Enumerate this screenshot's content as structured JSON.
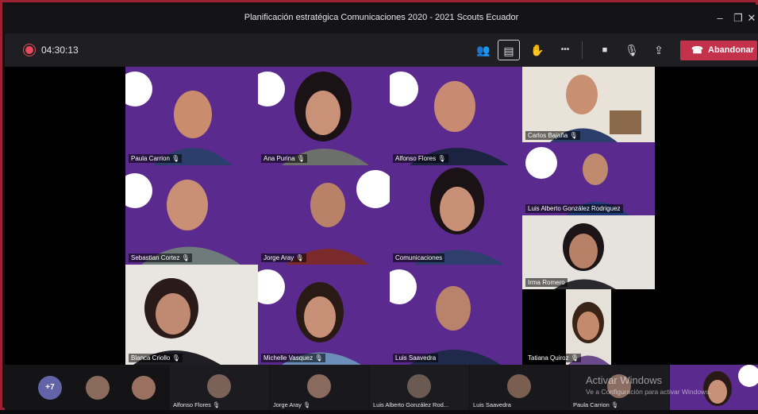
{
  "window": {
    "title": "Planificación estratégica Comunicaciones 2020 - 2021 Scouts Ecuador",
    "minimize_glyph": "–",
    "restore_glyph": "❐",
    "close_glyph": "✕"
  },
  "toolbar": {
    "timer": "04:30:13",
    "leave_label": "Abandonar",
    "buttons": [
      {
        "name": "participants-icon",
        "glyph": "👥"
      },
      {
        "name": "chat-icon",
        "glyph": "▤"
      },
      {
        "name": "raise-hand-icon",
        "glyph": "✋"
      },
      {
        "name": "more-options-icon",
        "glyph": "•••"
      },
      {
        "name": "camera-icon",
        "glyph": "■"
      },
      {
        "name": "microphone-icon",
        "glyph": "🎙"
      },
      {
        "name": "share-screen-icon",
        "glyph": "⇪"
      }
    ],
    "leave_icon_glyph": "☎"
  },
  "tiles": [
    {
      "name": "Paula Carrion",
      "mic": "🎙"
    },
    {
      "name": "Ana Purina",
      "mic": "🎙"
    },
    {
      "name": "Alfonso Flores",
      "mic": "🎙"
    },
    {
      "name": "Carlos Bajaña",
      "mic": "🎙"
    },
    {
      "name": "Sebastian Cortez",
      "mic": "🎙"
    },
    {
      "name": "Jorge Aray",
      "mic": "🎙"
    },
    {
      "name": "Comunicaciones",
      "mic": ""
    },
    {
      "name": "Luis Alberto González Rodriguez",
      "mic": ""
    },
    {
      "name": "Irma Romero",
      "mic": ""
    },
    {
      "name": "Blanca Criollo",
      "mic": "🎙"
    },
    {
      "name": "Michelle Vasquez",
      "mic": "🎙"
    },
    {
      "name": "Luis Saavedra",
      "mic": ""
    },
    {
      "name": "Tatiana Quiroz",
      "mic": "🎙"
    }
  ],
  "strip": {
    "overflow_count": "+7",
    "participants": [
      {
        "label": "Alfonso Flores",
        "mic": "🎙"
      },
      {
        "label": "Jorge Aray",
        "mic": "🎙"
      },
      {
        "label": "Luis Alberto González Rod...",
        "mic": ""
      },
      {
        "label": "Luis Saavedra",
        "mic": ""
      },
      {
        "label": "Paula Carrion",
        "mic": "🎙"
      }
    ]
  },
  "watermark": {
    "line1": "Activar Windows",
    "line2": "Ve a Configuración para activar Windows."
  },
  "colors": {
    "accent": "#6264a7",
    "leave": "#c4314b",
    "tile_purple": "#5b2a8e"
  }
}
